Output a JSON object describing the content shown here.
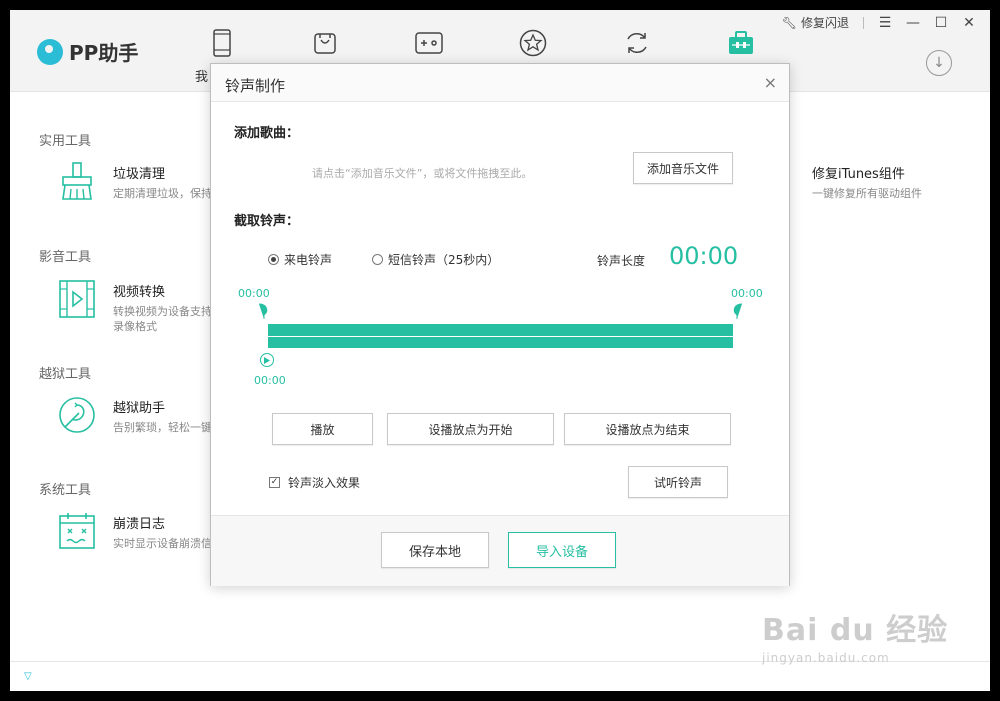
{
  "app": {
    "logo_text": "PP助手",
    "nav_partial_label": "我",
    "window": {
      "repair_label": "修复闪退",
      "menu_glyph": "☰",
      "min_glyph": "—",
      "max_glyph": "☐",
      "close_glyph": "✕"
    },
    "nav_icons": [
      "phone-icon",
      "bag-icon",
      "gamepad-icon",
      "star-icon",
      "sync-icon",
      "toolbox-icon"
    ],
    "accent_color": "#26bfa2"
  },
  "sections": [
    {
      "title": "实用工具",
      "tool": {
        "name": "垃圾清理",
        "desc": "定期清理垃圾，保持",
        "icon": "broom-icon"
      }
    },
    {
      "title": "影音工具",
      "tool": {
        "name": "视频转换",
        "desc": "转换视频为设备支持",
        "desc2": "录像格式",
        "icon": "video-file-icon"
      }
    },
    {
      "title": "越狱工具",
      "tool": {
        "name": "越狱助手",
        "desc": "告别繁琐，轻松一键",
        "icon": "jailbreak-icon"
      }
    },
    {
      "title": "系统工具",
      "tool": {
        "name": "崩溃日志",
        "desc": "实时显示设备崩溃信",
        "icon": "calendar-log-icon"
      }
    }
  ],
  "right_tool": {
    "name": "修复iTunes组件",
    "desc": "一键修复所有驱动组件"
  },
  "dialog": {
    "title": "铃声制作",
    "close_glyph": "×",
    "add_song_label": "添加歌曲：",
    "hint": "请点击“添加音乐文件”，或将文件拖拽至此。",
    "add_music_button": "添加音乐文件",
    "cut_label": "截取铃声：",
    "radio_call": "来电铃声",
    "radio_sms": "短信铃声（25秒内）",
    "length_label": "铃声长度",
    "length_value": "00:00",
    "start_time": "00:00",
    "end_time": "00:00",
    "play_time": "00:00",
    "play_button": "播放",
    "set_start_button": "设播放点为开始",
    "set_end_button": "设播放点为结束",
    "fade_label": "铃声淡入效果",
    "fade_checked": "✓",
    "preview_button": "试听铃声",
    "save_button": "保存本地",
    "import_button": "导入设备"
  },
  "watermark": {
    "big": "Bai du 经验",
    "small": "jingyan.baidu.com"
  }
}
